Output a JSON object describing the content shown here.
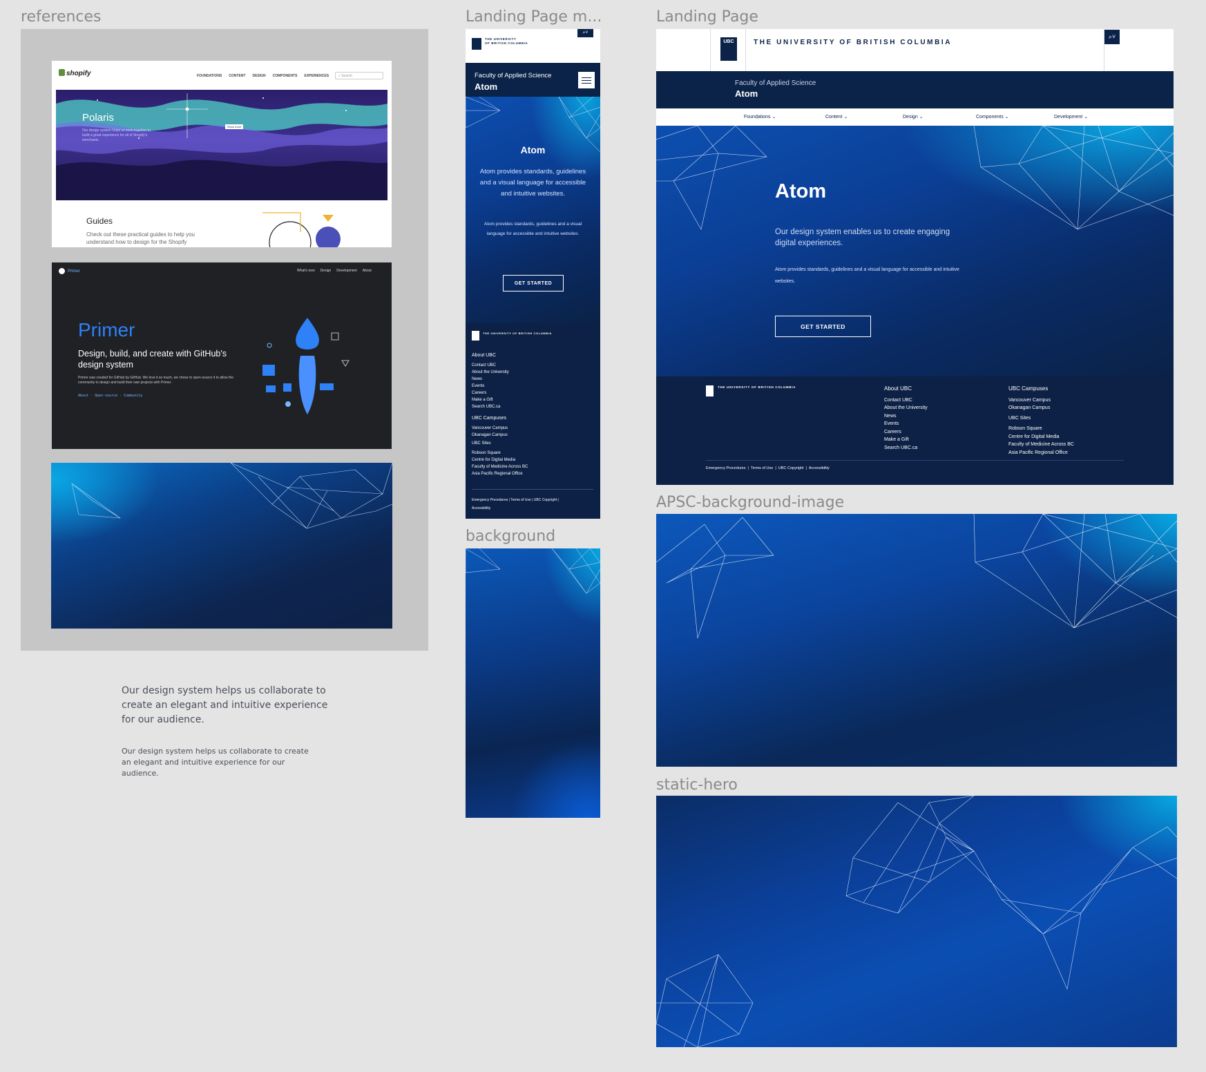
{
  "labels": {
    "references": "references",
    "landing_mobile": "Landing Page m...",
    "landing": "Landing Page",
    "background": "background",
    "apsc_bg": "APSC-background-image",
    "static_hero": "static-hero"
  },
  "shopify": {
    "brand": "shopify",
    "nav": [
      "FOUNDATIONS",
      "CONTENT",
      "DESIGN",
      "COMPONENTS",
      "EXPERIENCES"
    ],
    "search_placeholder": "Search",
    "hero_title": "Polaris",
    "hero_text": "Our design system helps us work together to build a great experience for all of Shopify's merchants.",
    "show_more": "Show more",
    "guides_title": "Guides",
    "guides_text": "Check out these practical guides to help you understand how to design for the Shopify"
  },
  "primer": {
    "brand": "Primer",
    "nav": [
      "What's new",
      "Design",
      "Development",
      "About"
    ],
    "title": "Primer",
    "subtitle": "Design, build, and create with GitHub's design system",
    "text": "Primer was created for GitHub by GitHub. We love it so much, we chose to open-source it to allow the community to design and build their own projects with Primer.",
    "links": "About · Open-source · Community"
  },
  "notes": {
    "large": "Our design system helps us collaborate to create an elegant and intuitive experience for our audience.",
    "small": "Our design system helps us collaborate to create an elegant and intuitive experience for our audience."
  },
  "mobile": {
    "univ_line1": "THE UNIVERSITY",
    "univ_line2": "OF BRITISH COLUMBIA",
    "faculty": "Faculty of Applied Science",
    "site": "Atom",
    "hero_title": "Atom",
    "hero_p1": "Atom provides standards, guidelines and a visual language for accessible and intuitive websites.",
    "hero_p2": "Atom provides standards, guidelines and a visual language for accessible and intuitive websites.",
    "cta": "GET STARTED",
    "footer_univ": "THE UNIVERSITY OF BRITISH COLUMBIA",
    "about_head": "About UBC",
    "about_links": [
      "Contact UBC",
      "About the University",
      "News",
      "Events",
      "Careers",
      "Make a Gift",
      "Search UBC.ca"
    ],
    "campus_head": "UBC Campuses",
    "campus_links": [
      "Vancouver Campus",
      "Okanagan Campus"
    ],
    "sites_head": "UBC Sites",
    "sites_links": [
      "Robson Square",
      "Centre for Digital Media",
      "Faculty of Medicine Across BC",
      "Asia Pacific Regional Office"
    ],
    "legal": [
      "Emergency Procedures",
      "Terms of Use",
      "UBC Copyright",
      "Accessibility"
    ]
  },
  "landing": {
    "univ": "THE UNIVERSITY OF BRITISH COLUMBIA",
    "ubc": "UBC",
    "faculty": "Faculty of Applied Science",
    "site": "Atom",
    "nav": [
      "Foundations",
      "Content",
      "Design",
      "Components",
      "Development"
    ],
    "hero_title": "Atom",
    "hero_lead": "Our design system enables us to create engaging digital experiences.",
    "hero_text": "Atom provides standards, guidelines and a visual language for accessible and intuitive websites.",
    "cta": "GET STARTED",
    "footer_univ": "THE UNIVERSITY OF BRITISH COLUMBIA",
    "about_head": "About UBC",
    "about_links": [
      "Contact UBC",
      "About the University",
      "News",
      "Events",
      "Careers",
      "Make a Gift",
      "Search UBC.ca"
    ],
    "campus_head": "UBC Campuses",
    "campus_links": [
      "Vancouver Campus",
      "Okanagan Campus"
    ],
    "sites_head": "UBC Sites",
    "sites_links": [
      "Robson Square",
      "Centre for Digital Media",
      "Faculty of Medicine Across BC",
      "Asia Pacific Regional Office"
    ],
    "legal": [
      "Emergency Procedures",
      "Terms of Use",
      "UBC Copyright",
      "Accessibility"
    ]
  },
  "colors": {
    "canvas": "#e4e4e4",
    "ubc_navy": "#0b2349",
    "hero_blue": "#0c4fb0",
    "accent_cyan": "#0aa1dd",
    "primer_blue": "#2f81f7"
  }
}
